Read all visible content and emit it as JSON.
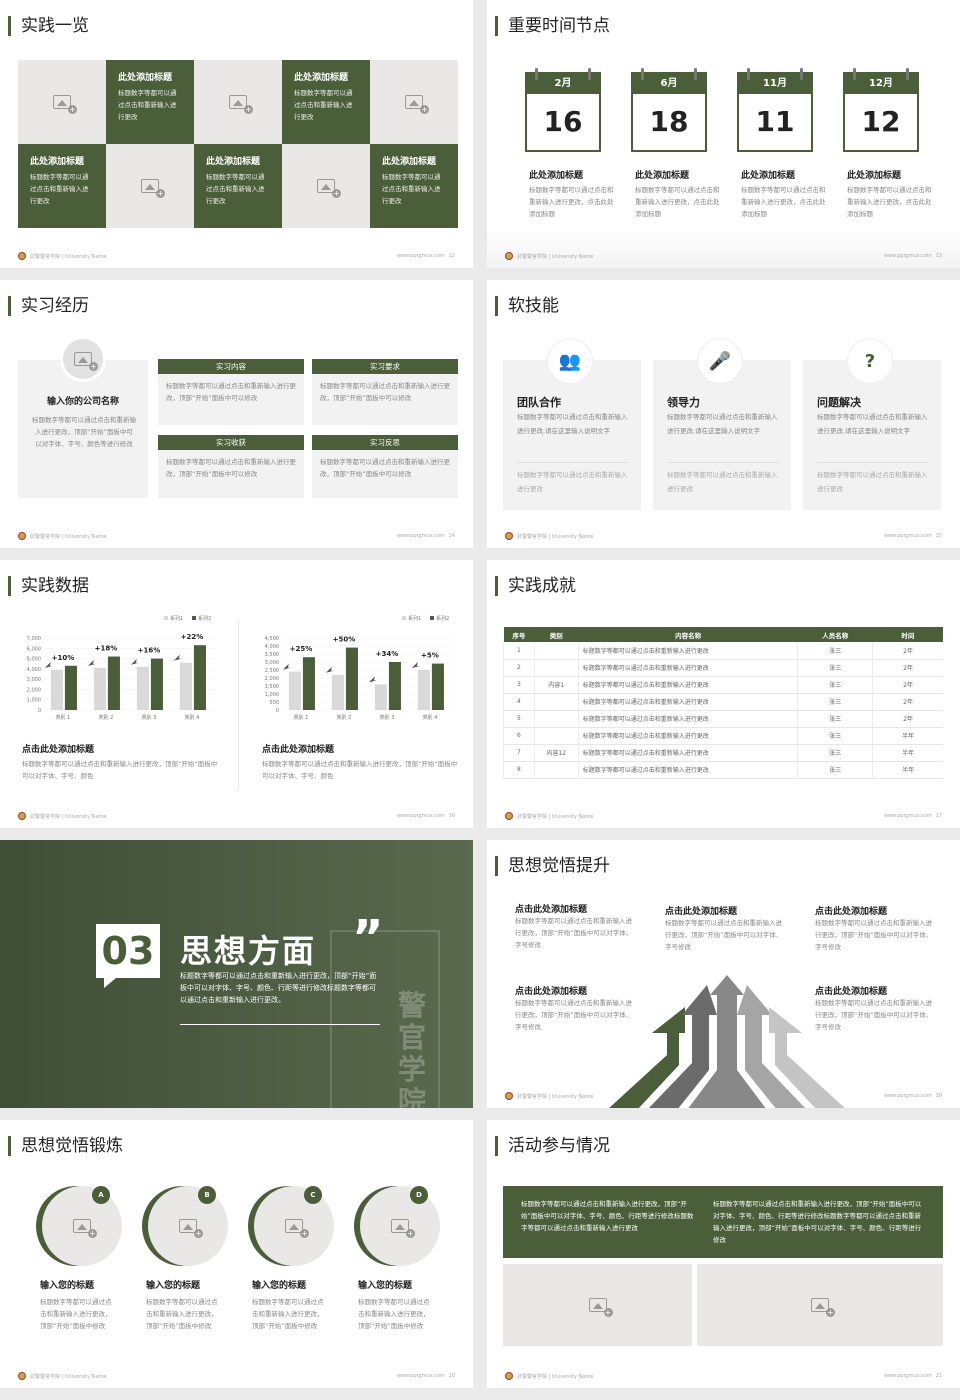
{
  "footer": {
    "left": "武警警官学院 | University Name",
    "url": "www.pptgmus.com"
  },
  "s12": {
    "title": "实践一览",
    "page": "12",
    "tiles": [
      {
        "title": "此处添加标题",
        "text": "标题数字等都可以通过点击和重新输入进行更改"
      },
      {
        "title": "此处添加标题",
        "text": "标题数字等都可以通过点击和重新输入进行更改"
      },
      {
        "title": "此处添加标题",
        "text": "标题数字等都可以通过点击和重新输入进行更改"
      },
      {
        "title": "此处添加标题",
        "text": "标题数字等都可以通过点击和重新输入进行更改"
      },
      {
        "title": "此处添加标题",
        "text": "标题数字等都可以通过点击和重新输入进行更改"
      }
    ]
  },
  "s13": {
    "title": "重要时间节点",
    "page": "13",
    "items": [
      {
        "month": "2月",
        "day": "16",
        "title": "此处添加标题",
        "text": "标题数字等都可以通过点击和重新输入进行更改，点击此处添加标题"
      },
      {
        "month": "6月",
        "day": "18",
        "title": "此处添加标题",
        "text": "标题数字等都可以通过点击和重新输入进行更改，点击此处添加标题"
      },
      {
        "month": "11月",
        "day": "11",
        "title": "此处添加标题",
        "text": "标题数字等都可以通过点击和重新输入进行更改，点击此处添加标题"
      },
      {
        "month": "12月",
        "day": "12",
        "title": "此处添加标题",
        "text": "标题数字等都可以通过点击和重新输入进行更改，点击此处添加标题"
      }
    ]
  },
  "s14": {
    "title": "实习经历",
    "page": "14",
    "company": "输入你的公司名称",
    "company_text": "标题数字等都可以通过点击和重新输入进行更改，顶部“开始”面板中可以对字体、字号、颜色等进行修改",
    "boxes": [
      {
        "head": "实习内容",
        "text": "标题数字等都可以通过点击和重新输入进行更改，顶部“开始”面板中可以修改"
      },
      {
        "head": "实习要求",
        "text": "标题数字等都可以通过点击和重新输入进行更改，顶部“开始”面板中可以修改"
      },
      {
        "head": "实习收获",
        "text": "标题数字等都可以通过点击和重新输入进行更改，顶部“开始”面板中可以修改"
      },
      {
        "head": "实习反思",
        "text": "标题数字等都可以通过点击和重新输入进行更改，顶部“开始”面板中可以修改"
      }
    ]
  },
  "s15": {
    "title": "软技能",
    "page": "15",
    "cards": [
      {
        "icon": "team-icon",
        "title": "团队合作",
        "text": "标题数字等都可以通过点击和重新输入进行更改,请在这里输入说明文字",
        "text2": "标题数字等都可以通过点击和重新输入进行更改"
      },
      {
        "icon": "podium-icon",
        "title": "领导力",
        "text": "标题数字等都可以通过点击和重新输入进行更改,请在这里输入说明文字",
        "text2": "标题数字等都可以通过点击和重新输入进行更改"
      },
      {
        "icon": "question-icon",
        "title": "问题解决",
        "text": "标题数字等都可以通过点击和重新输入进行更改,请在这里输入说明文字",
        "text2": "标题数字等都可以通过点击和重新输入进行更改"
      }
    ]
  },
  "s16": {
    "title": "实践数据",
    "page": "16",
    "captions": [
      {
        "title": "点击此处添加标题",
        "text": "标题数字等都可以通过点击和重新输入进行更改，顶部“开始”面板中可以对字体、字号、颜色"
      },
      {
        "title": "点击此处添加标题",
        "text": "标题数字等都可以通过点击和重新输入进行更改，顶部“开始”面板中可以对字体、字号、颜色"
      }
    ]
  },
  "chart_data": [
    {
      "type": "bar",
      "legend": [
        "系列1",
        "系列2"
      ],
      "legend_position": "top-right",
      "categories": [
        "类别 1",
        "类别 2",
        "类别 3",
        "类别 4"
      ],
      "series": [
        {
          "name": "系列1",
          "values": [
            3900,
            4100,
            4200,
            4600
          ]
        },
        {
          "name": "系列2",
          "values": [
            4300,
            5200,
            5000,
            6300
          ]
        }
      ],
      "ylim": [
        0,
        7000
      ],
      "yticks": [
        "0",
        "1,000",
        "2,000",
        "3,000",
        "4,000",
        "5,000",
        "6,000",
        "7,000"
      ],
      "annotations": [
        "+10%",
        "+18%",
        "+16%",
        "+22%"
      ]
    },
    {
      "type": "bar",
      "legend": [
        "系列1",
        "系列2"
      ],
      "legend_position": "top-right",
      "categories": [
        "类别 1",
        "类别 2",
        "类别 3",
        "类别 4"
      ],
      "series": [
        {
          "name": "系列1",
          "values": [
            2400,
            2200,
            1600,
            2500
          ]
        },
        {
          "name": "系列2",
          "values": [
            3300,
            3900,
            3000,
            2900
          ]
        }
      ],
      "ylim": [
        0,
        4500
      ],
      "yticks": [
        "0",
        "500",
        "1,000",
        "1,500",
        "2,000",
        "2,500",
        "3,000",
        "3,500",
        "4,000",
        "4,500"
      ],
      "annotations": [
        "+25%",
        "+50%",
        "+34%",
        "+5%"
      ]
    }
  ],
  "s17": {
    "title": "实践成就",
    "page": "17",
    "headers": [
      "序号",
      "类别",
      "内容名称",
      "人员名称",
      "时间"
    ],
    "rows": [
      [
        "1",
        "",
        "标题数字等都可以通过点击和重新输入进行更改",
        "张三",
        "2年"
      ],
      [
        "2",
        "",
        "标题数字等都可以通过点击和重新输入进行更改",
        "张三",
        "2年"
      ],
      [
        "3",
        "内容1",
        "标题数字等都可以通过点击和重新输入进行更改",
        "张三",
        "2年"
      ],
      [
        "4",
        "",
        "标题数字等都可以通过点击和重新输入进行更改",
        "张三",
        "2年"
      ],
      [
        "5",
        "",
        "标题数字等都可以通过点击和重新输入进行更改",
        "张三",
        "2年"
      ],
      [
        "6",
        "",
        "标题数字等都可以通过点击和重新输入进行更改",
        "张三",
        "半年"
      ],
      [
        "7",
        "内容12",
        "标题数字等都可以通过点击和重新输入进行更改",
        "张三",
        "半年"
      ],
      [
        "8",
        "",
        "标题数字等都可以通过点击和重新输入进行更改",
        "张三",
        "半年"
      ]
    ]
  },
  "s18": {
    "num": "03",
    "title": "思想方面",
    "quote": "”",
    "text": "标题数字等都可以通过点击和重新输入进行更改，顶部“开始”面板中可以对字体、字号、颜色、行距等进行修改标题数字等都可以通过点击和重新输入进行更改。",
    "bg_text": "警官学院"
  },
  "s19": {
    "title": "思想觉悟提升",
    "page": "19",
    "blocks": [
      {
        "title": "点击此处添加标题",
        "text": "标题数字等都可以通过点击和重新输入进行更改，顶部“开始”面板中可以对字体、字号修改"
      },
      {
        "title": "点击此处添加标题",
        "text": "标题数字等都可以通过点击和重新输入进行更改，顶部“开始”面板中可以对字体、字号修改"
      },
      {
        "title": "点击此处添加标题",
        "text": "标题数字等都可以通过点击和重新输入进行更改，顶部“开始”面板中可以对字体、字号修改"
      },
      {
        "title": "点击此处添加标题",
        "text": "标题数字等都可以通过点击和重新输入进行更改，顶部“开始”面板中可以对字体、字号修改"
      },
      {
        "title": "点击此处添加标题",
        "text": "标题数字等都可以通过点击和重新输入进行更改，顶部“开始”面板中可以对字体、字号修改"
      }
    ]
  },
  "s20": {
    "title": "思想觉悟锻炼",
    "page": "20",
    "items": [
      {
        "letter": "A",
        "title": "输入您的标题",
        "text": "标题数字等都可以通过点击和重新输入进行更改，顶部“开始”面板中修改"
      },
      {
        "letter": "B",
        "title": "输入您的标题",
        "text": "标题数字等都可以通过点击和重新输入进行更改，顶部“开始”面板中修改"
      },
      {
        "letter": "C",
        "title": "输入您的标题",
        "text": "标题数字等都可以通过点击和重新输入进行更改，顶部“开始”面板中修改"
      },
      {
        "letter": "D",
        "title": "输入您的标题",
        "text": "标题数字等都可以通过点击和重新输入进行更改，顶部“开始”面板中修改"
      }
    ]
  },
  "s21": {
    "title": "活动参与情况",
    "page": "21",
    "text_left": "标题数字等都可以通过点击和重新输入进行更改，顶部“开始”面板中可以对字体、字号、颜色、行距等进行修改标题数字等都可以通过点击和重新输入进行更改",
    "text_right": "标题数字等都可以通过点击和重新输入进行更改，顶部“开始”面板中可以对字体、字号、颜色、行距等进行修改标题数字等都可以通过点击和重新输入进行更改，顶部“开始”面板中可以对字体、字号、颜色、行距等进行修改"
  },
  "colors": {
    "accent": "#4a5e3a",
    "gray": "#e9e8e7",
    "bar_light": "#d9d9d9"
  }
}
